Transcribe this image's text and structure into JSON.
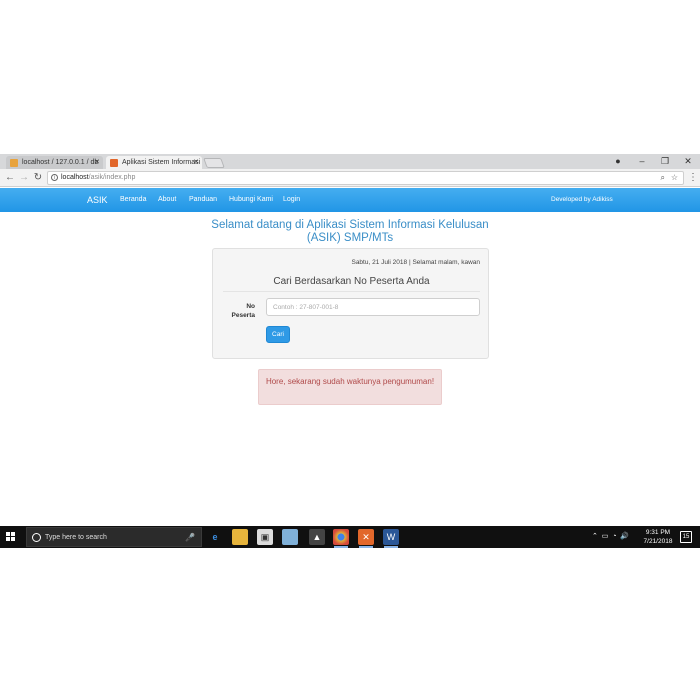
{
  "browser": {
    "tabs": [
      {
        "label": "localhost / 127.0.0.1 / db"
      },
      {
        "label": "Aplikasi Sistem Informasi"
      }
    ],
    "url_host": "localhost",
    "url_path": "/asik/index.php"
  },
  "navbar": {
    "brand": "ASIK",
    "links": [
      "Beranda",
      "About",
      "Panduan",
      "Hubungi Kami",
      "Login"
    ],
    "developer": "Developed by Adikiss"
  },
  "main": {
    "title": "Selamat datang di Aplikasi Sistem Informasi Kelulusan (ASIK) SMP/MTs",
    "date_line": "Sabtu, 21 Juli 2018 | Selamat malam, kawan",
    "panel_heading": "Cari Berdasarkan No Peserta Anda",
    "field_label": "No Peserta",
    "input_placeholder": "Contoh : 27-807-001-8",
    "button_label": "Cari",
    "alert_text": "Hore, sekarang sudah waktunya pengumuman!"
  },
  "taskbar": {
    "search_placeholder": "Type here to search",
    "time": "9:31 PM",
    "date": "7/21/2018",
    "notification_count": "15"
  },
  "colors": {
    "navbar": "#2196e6",
    "title": "#3a8ec7",
    "button": "#2f9ae6",
    "alert_bg": "#f2dede",
    "alert_text": "#b04a4a"
  }
}
